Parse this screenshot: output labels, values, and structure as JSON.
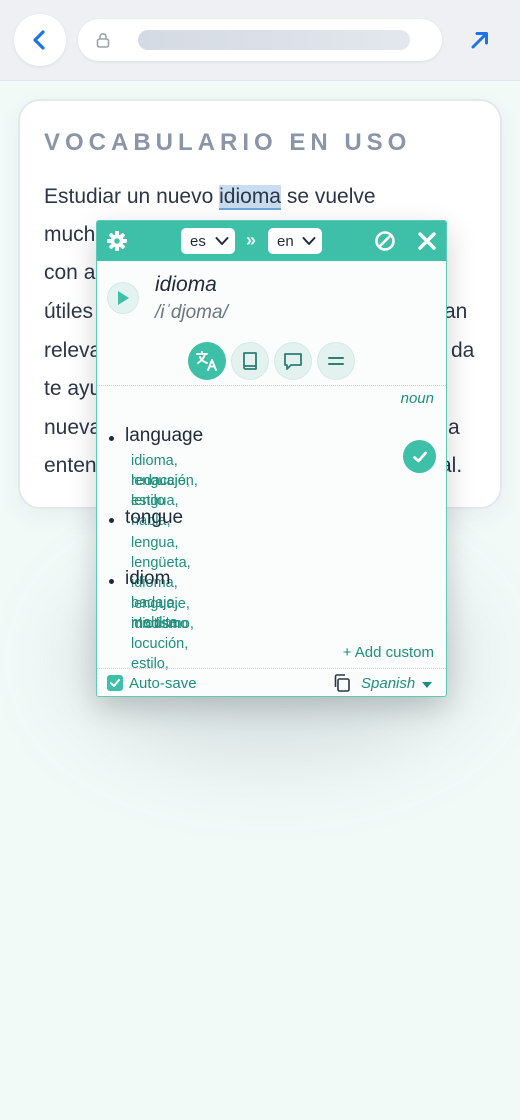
{
  "colors": {
    "accent": "#3dbfa8",
    "accent_text": "#1f8f7c",
    "link_blue": "#1a73e8",
    "highlight": "#c9dcf0"
  },
  "topbar": {
    "back_icon": "chevron-left-icon",
    "lock_icon": "lock-icon",
    "open_icon": "arrow-up-right-icon"
  },
  "article": {
    "title": "VOCABULARIO EN USO",
    "lines": [
      {
        "before": "Estudiar un nuevo ",
        "highlight": "idioma",
        "after": " se vuelve"
      },
      {
        "left": "much",
        "right": ""
      },
      {
        "left": "con a",
        "right": ""
      },
      {
        "left": "útiles",
        "right": "an"
      },
      {
        "left": "releva",
        "right": "da"
      },
      {
        "left": "te ayu",
        "right": ""
      },
      {
        "left": "nueva",
        "right": "a"
      },
      {
        "left": "enten",
        "right": "al."
      }
    ]
  },
  "popup": {
    "source_lang": "es",
    "target_lang": "en",
    "swap_glyph": "»",
    "word": "idioma",
    "phonetic": "/iˈdjoma/",
    "tabs": [
      {
        "name": "translate-icon",
        "active": true
      },
      {
        "name": "book-icon",
        "active": false
      },
      {
        "name": "speech-bubble-icon",
        "active": false
      },
      {
        "name": "equals-icon",
        "active": false
      }
    ],
    "part_of_speech": "noun",
    "definitions": [
      {
        "term": "language",
        "synonyms": [
          "idioma, lenguaje, lengua, habla,",
          "redacción, estilo"
        ],
        "saved": true
      },
      {
        "term": "tongue",
        "synonyms": [
          "lengua, lengüeta, idioma, badajo, maldita"
        ],
        "saved": false
      },
      {
        "term": "idiom",
        "synonyms": [
          "lenguaje, modismo, locución, estilo,",
          "idiotismo"
        ],
        "saved": false
      }
    ],
    "add_custom": "+ Add custom",
    "autosave_label": "Auto-save",
    "autosave_checked": true,
    "output_language": "Spanish"
  }
}
